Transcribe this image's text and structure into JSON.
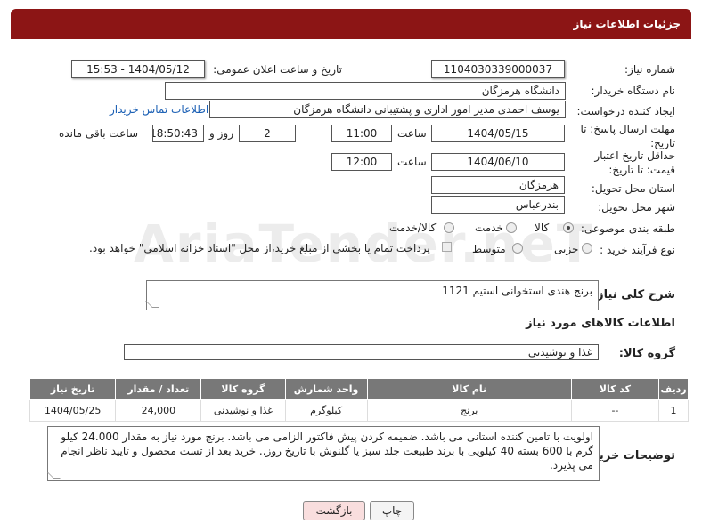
{
  "header": {
    "title": "جزئیات اطلاعات نیاز"
  },
  "fields": {
    "need_number_label": "شماره نیاز:",
    "need_number": "1104030339000037",
    "announce_label": "تاریخ و ساعت اعلان عمومی:",
    "announce_value": "1404/05/12 - 15:53",
    "buyer_org_label": "نام دستگاه خریدار:",
    "buyer_org": "دانشگاه هرمزگان",
    "creator_label": "ایجاد کننده درخواست:",
    "creator": "یوسف احمدی مدیر امور اداری و پشتیبانی دانشگاه هرمزگان",
    "contact_link": "اطلاعات تماس خریدار",
    "deadline_label": "مهلت ارسال پاسخ: تا تاریخ:",
    "deadline_date": "1404/05/15",
    "time_label": "ساعت",
    "deadline_time": "11:00",
    "days_value": "2",
    "days_label": "روز و",
    "remaining_time": "18:50:43",
    "remaining_label": "ساعت باقی مانده",
    "price_validity_label": "حداقل تاریخ اعتبار قیمت: تا تاریخ:",
    "price_validity_date": "1404/06/10",
    "price_validity_time": "12:00",
    "province_label": "استان محل تحویل:",
    "province": "هرمزگان",
    "city_label": "شهر محل تحویل:",
    "city": "بندرعباس",
    "category_label": "طبقه بندی موضوعی:",
    "category_options": [
      "کالا",
      "خدمت",
      "کالا/خدمت"
    ],
    "process_label": "نوع فرآیند خرید :",
    "process_options": [
      "جزیی",
      "متوسط"
    ],
    "payment_note": "پرداخت تمام یا بخشی از مبلغ خرید،از محل \"اسناد خزانه اسلامی\" خواهد بود."
  },
  "description": {
    "label": "شرح کلی نیاز:",
    "value": "برنج هندی استخوانی استیم 1121"
  },
  "goods_section": {
    "title": "اطلاعات کالاهای مورد نیاز",
    "group_label": "گروه کالا:",
    "group_value": "غذا و نوشیدنی"
  },
  "table": {
    "headers": [
      "ردیف",
      "کد کالا",
      "نام کالا",
      "واحد شمارش",
      "گروه کالا",
      "تعداد / مقدار",
      "تاریخ نیاز"
    ],
    "rows": [
      [
        "1",
        "--",
        "برنج",
        "کیلوگرم",
        "غذا و نوشیدنی",
        "24,000",
        "1404/05/25"
      ]
    ]
  },
  "buyer_notes": {
    "label": "توضیحات خریدار:",
    "value": "اولویت با تامین کننده استانی می باشد. ضمیمه کردن پیش فاکتور الزامی می باشد. برنج مورد نیاز به مقدار 24.000 کیلو گرم با 600 بسته 40 کیلویی با برند طبیعت جلد سبز یا گلنوش با تاریخ روز.. خرید بعد از تست محصول و تایید ناظر انجام می پذیرد."
  },
  "buttons": {
    "print": "چاپ",
    "back": "بازگشت"
  },
  "watermark": "AriaTender.neT",
  "colors": {
    "header": "#8c1515",
    "table_header": "#787878",
    "back_button": "#f9dede",
    "link": "#1a5fb4"
  }
}
